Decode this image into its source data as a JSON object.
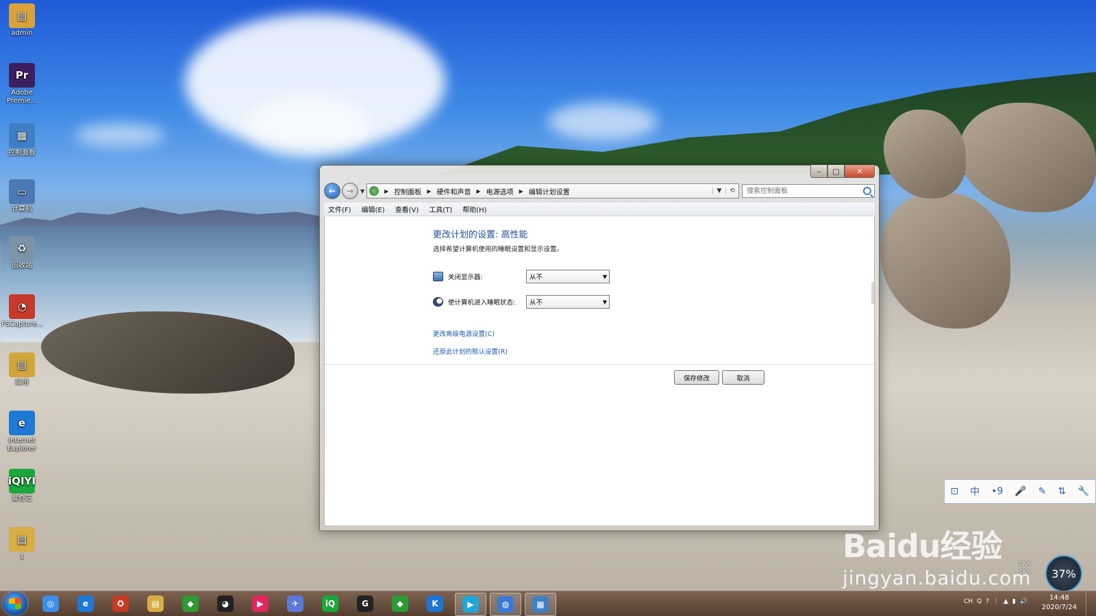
{
  "desktop": {
    "icons": [
      {
        "label": "admin",
        "glyph": "▤",
        "color": "#d9a23b"
      },
      {
        "label": "Adobe Premie...",
        "glyph": "Pr",
        "color": "#3b1f62"
      },
      {
        "label": "控制面板",
        "glyph": "▦",
        "color": "#3f7fc4"
      },
      {
        "label": "计算机",
        "glyph": "▭",
        "color": "#4a79b6"
      },
      {
        "label": "回收站",
        "glyph": "♻",
        "color": "#7c93a8"
      },
      {
        "label": "FSCapture...",
        "glyph": "◔",
        "color": "#c7392a"
      },
      {
        "label": "应用",
        "glyph": "▤",
        "color": "#d1a53a"
      },
      {
        "label": "Internet Explorer",
        "glyph": "e",
        "color": "#1e78d6"
      },
      {
        "label": "爱奇艺",
        "glyph": "iQIYI",
        "color": "#1aa83c"
      },
      {
        "label": "1",
        "glyph": "▤",
        "color": "#d8ad45"
      }
    ]
  },
  "window": {
    "controls": {
      "min": "–",
      "max": "□",
      "close": "✕"
    },
    "breadcrumb": [
      "控制面板",
      "硬件和声音",
      "电源选项",
      "编辑计划设置"
    ],
    "search_placeholder": "搜索控制面板",
    "menu": [
      "文件(F)",
      "编辑(E)",
      "查看(V)",
      "工具(T)",
      "帮助(H)"
    ],
    "title": "更改计划的设置: 高性能",
    "description": "选择希望计算机使用的睡眠设置和显示设置。",
    "settings": [
      {
        "label": "关闭显示器:",
        "value": "从不",
        "icon": "monitor-icon"
      },
      {
        "label": "使计算机进入睡眠状态:",
        "value": "从不",
        "icon": "moon-icon"
      }
    ],
    "links": {
      "advanced": "更改高级电源设置(C)",
      "restore": "还原此计划的默认设置(R)"
    },
    "buttons": {
      "save": "保存修改",
      "cancel": "取消"
    }
  },
  "ime_toolbar": [
    "⊡",
    "中",
    "•9",
    "🎤",
    "✎",
    "⇅",
    "🔧"
  ],
  "watermark": {
    "brand": "Baidu经验",
    "url": "jingyan.baidu.com"
  },
  "network": {
    "up": "0K/s",
    "down": "0K/s",
    "cpu_label": "37%"
  },
  "taskbar": {
    "apps": [
      {
        "name": "baidu-netdisk",
        "glyph": "◎",
        "color": "#3c8ee8"
      },
      {
        "name": "internet-explorer",
        "glyph": "e",
        "color": "#1f78d6"
      },
      {
        "name": "app-red",
        "glyph": "✪",
        "color": "#c83a22"
      },
      {
        "name": "file-explorer",
        "glyph": "▤",
        "color": "#d8ad45"
      },
      {
        "name": "green-app",
        "glyph": "◆",
        "color": "#2c9a36"
      },
      {
        "name": "qq",
        "glyph": "◕",
        "color": "#222"
      },
      {
        "name": "youku",
        "glyph": "▶",
        "color": "#e2265f"
      },
      {
        "name": "feishu",
        "glyph": "✈",
        "color": "#5a79d9"
      },
      {
        "name": "iqiyi",
        "glyph": "iQ",
        "color": "#1aa83c"
      },
      {
        "name": "app-g",
        "glyph": "G",
        "color": "#222"
      },
      {
        "name": "green-app-2",
        "glyph": "◆",
        "color": "#2c9a36"
      },
      {
        "name": "kugou",
        "glyph": "K",
        "color": "#1a76d2"
      },
      {
        "name": "video-player",
        "glyph": "▶",
        "color": "#22a6d8"
      },
      {
        "name": "browser-app",
        "glyph": "◍",
        "color": "#3a7bd5"
      },
      {
        "name": "control-panel",
        "glyph": "▦",
        "color": "#3f7fc4"
      }
    ],
    "tray": [
      "CH",
      "Q",
      "?",
      "⋮",
      "▲",
      "▮",
      "🔊"
    ],
    "time": "14:48",
    "date": "2020/7/24"
  }
}
